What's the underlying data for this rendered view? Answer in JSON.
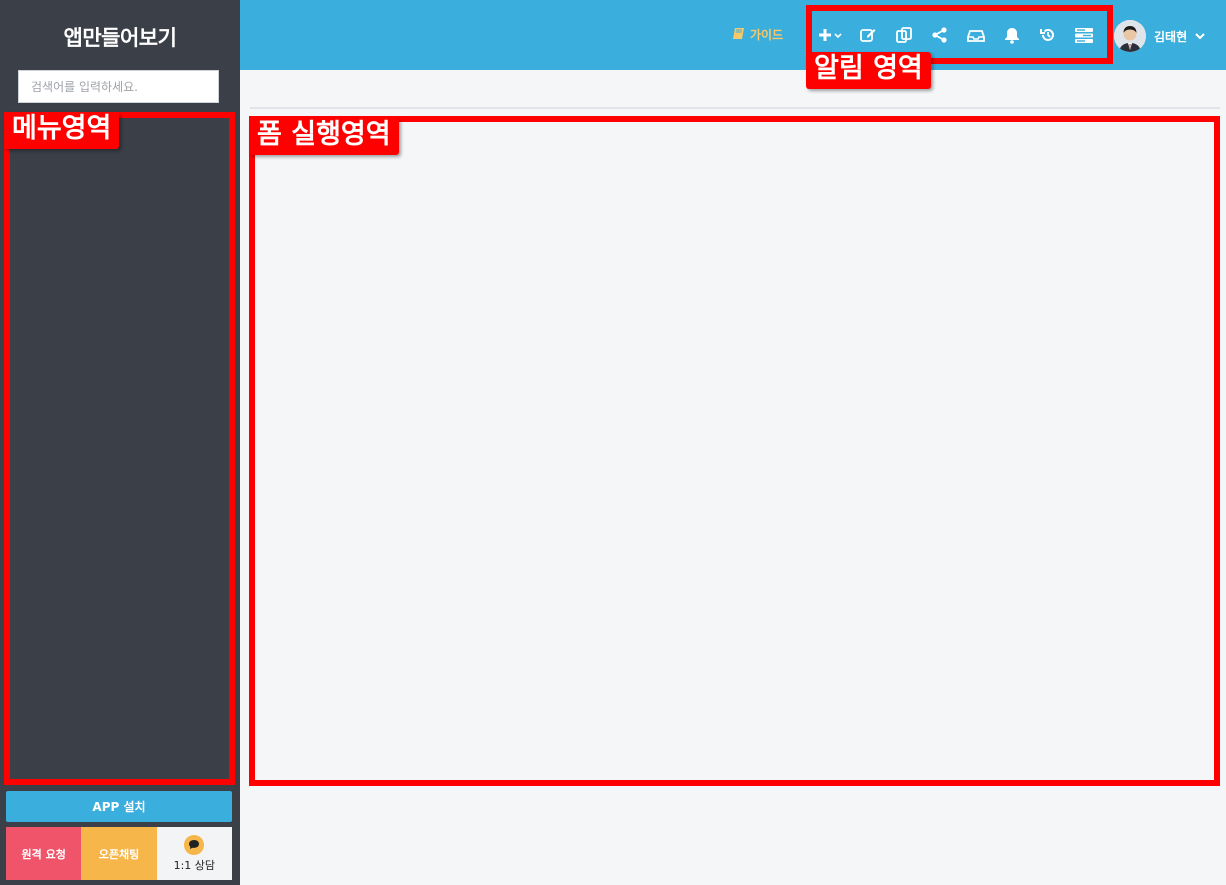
{
  "sidebar": {
    "app_title": "앱만들어보기",
    "search_placeholder": "검색어를 입력하세요.",
    "app_install_label": "APP 설치",
    "remote_request_label": "원격 요청",
    "open_chat_label": "오픈채팅",
    "consult_label": "1:1 상담"
  },
  "topbar": {
    "guide_label": "가이드",
    "user_name": "김태현",
    "icons": [
      "plus-icon",
      "edit-icon",
      "copy-icon",
      "share-icon",
      "inbox-icon",
      "bell-icon",
      "history-icon",
      "list-icon"
    ]
  },
  "annotations": {
    "menu_area": "메뉴영역",
    "form_area": "폼 실행영역",
    "notification_area": "알림 영역"
  },
  "colors": {
    "sidebar_bg": "#3a3f48",
    "topbar_bg": "#3aaedc",
    "annotation_red": "#ff0000",
    "remote_btn": "#f0546a",
    "chat_btn": "#f7b64a",
    "guide_text": "#f7c96a"
  }
}
